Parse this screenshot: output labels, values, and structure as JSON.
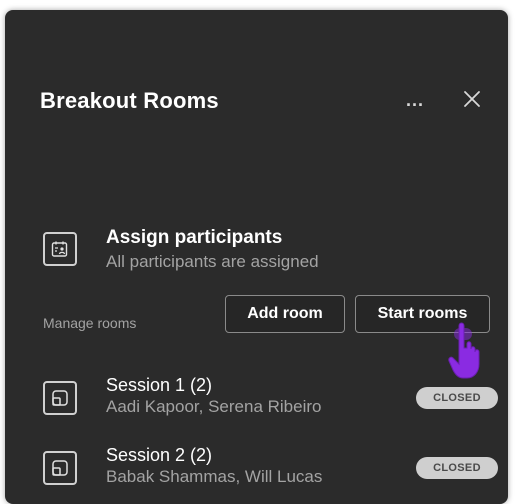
{
  "panel": {
    "title": "Breakout Rooms",
    "more_label": "...",
    "close_label": "×"
  },
  "assign": {
    "title": "Assign participants",
    "subtitle": "All participants are assigned"
  },
  "manage": {
    "label": "Manage rooms",
    "add_room_label": "Add room",
    "start_rooms_label": "Start rooms"
  },
  "rooms": [
    {
      "name": "Session 1 (2)",
      "members": "Aadi Kapoor, Serena Ribeiro",
      "status": "CLOSED"
    },
    {
      "name": "Session 2 (2)",
      "members": "Babak Shammas, Will Lucas",
      "status": "CLOSED"
    }
  ],
  "icons": {
    "more": "more-options-icon",
    "close": "close-icon",
    "assign": "assign-participants-icon",
    "room": "room-icon",
    "cursor": "hand-pointer-icon"
  },
  "colors": {
    "panel_bg": "#2b2b2b",
    "secondary_text": "#a3a3a3",
    "badge_bg": "#cfcfcf",
    "cursor_accent": "#8a2be2"
  }
}
